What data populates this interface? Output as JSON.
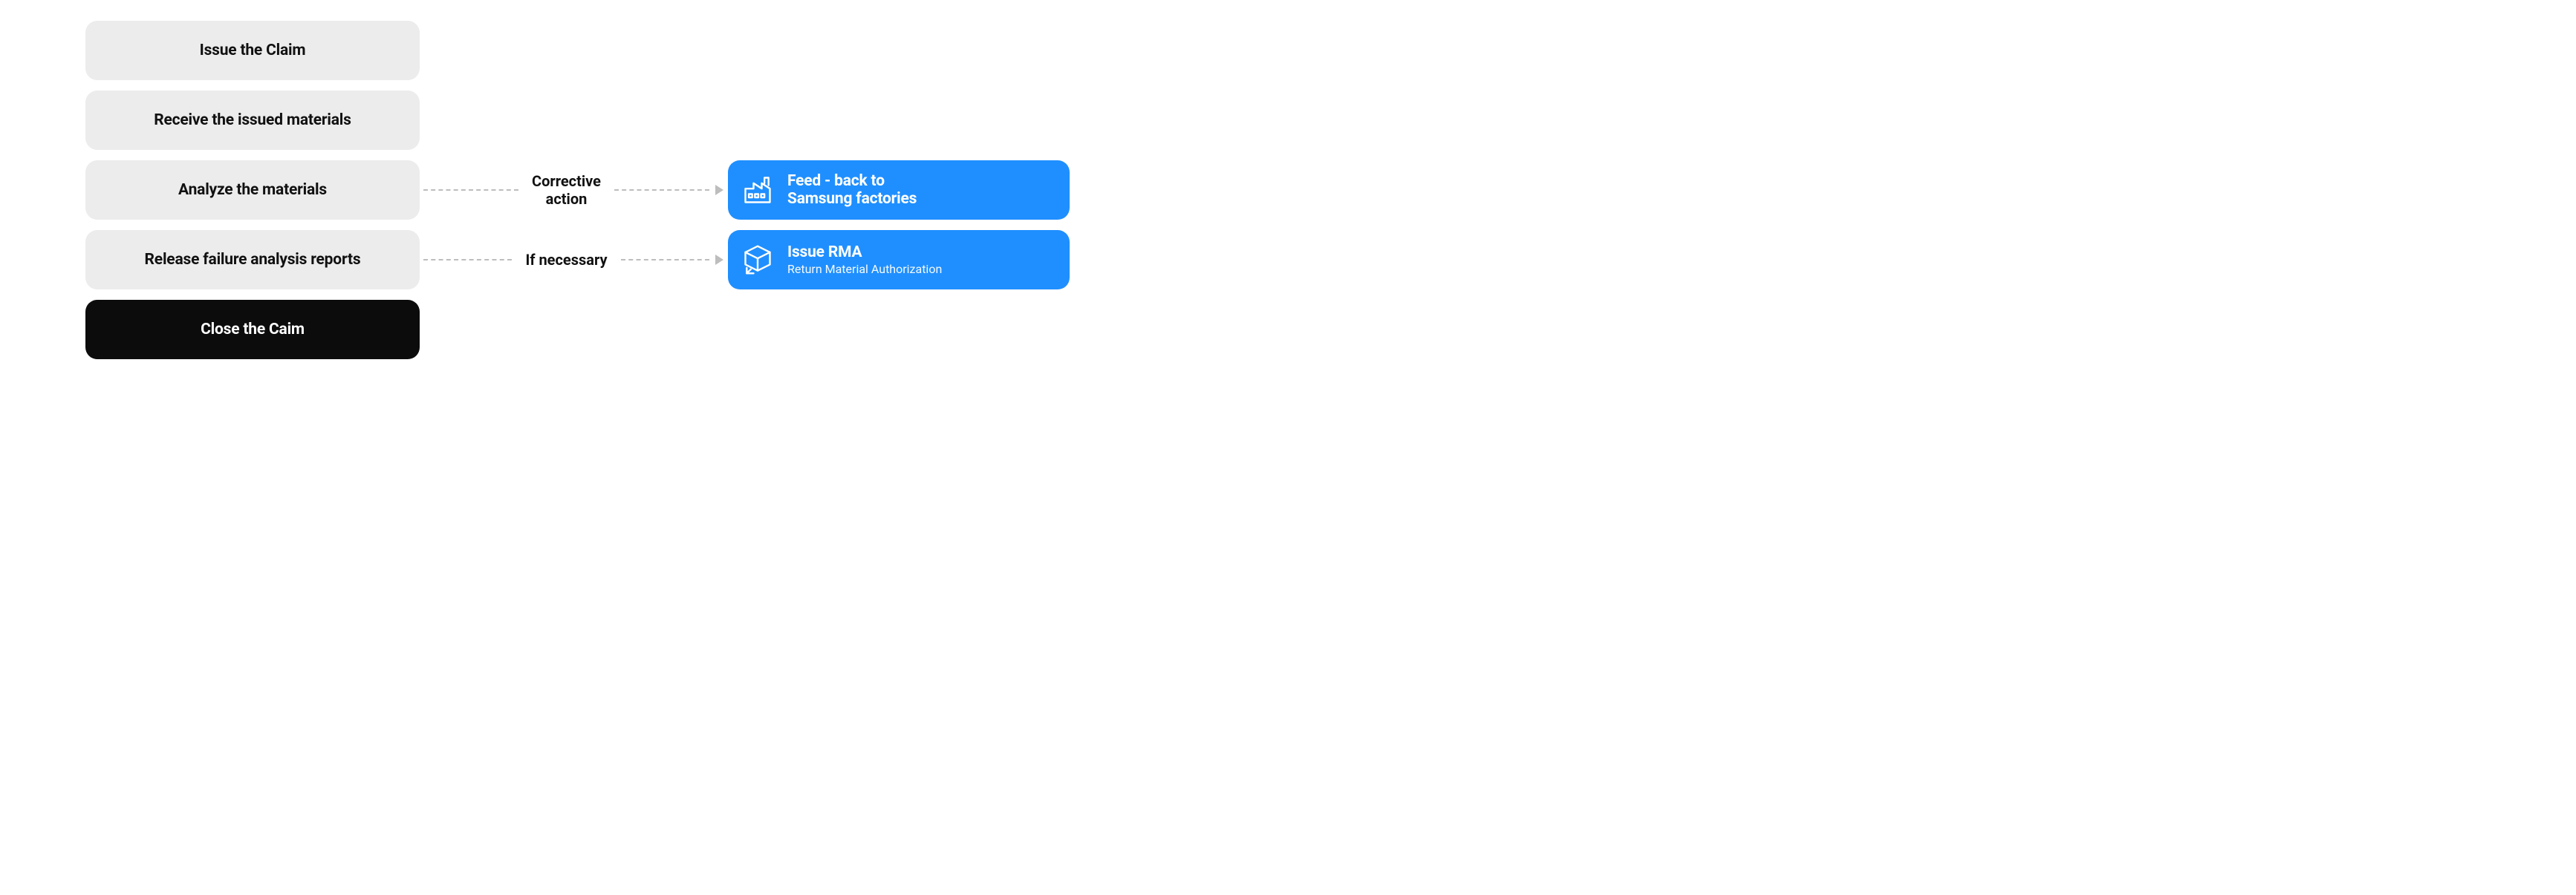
{
  "steps": [
    {
      "label": "Issue the Claim",
      "final": false
    },
    {
      "label": "Receive the issued materials",
      "final": false
    },
    {
      "label": "Analyze the materials",
      "final": false
    },
    {
      "label": "Release failure analysis reports",
      "final": false
    },
    {
      "label": "Close the Caim",
      "final": true
    }
  ],
  "connectors": [
    {
      "label": "Corrective\naction"
    },
    {
      "label": "If necessary"
    }
  ],
  "results": [
    {
      "icon": "factory-icon",
      "title": "Feed - back to\nSamsung factories",
      "sub": ""
    },
    {
      "icon": "box-return-icon",
      "title": "Issue RMA",
      "sub": "Return Material Authorization"
    }
  ],
  "colors": {
    "step_bg": "#ececec",
    "final_bg": "#0c0c0c",
    "result_bg": "#1f8fff",
    "dash": "#bdbdbd"
  }
}
